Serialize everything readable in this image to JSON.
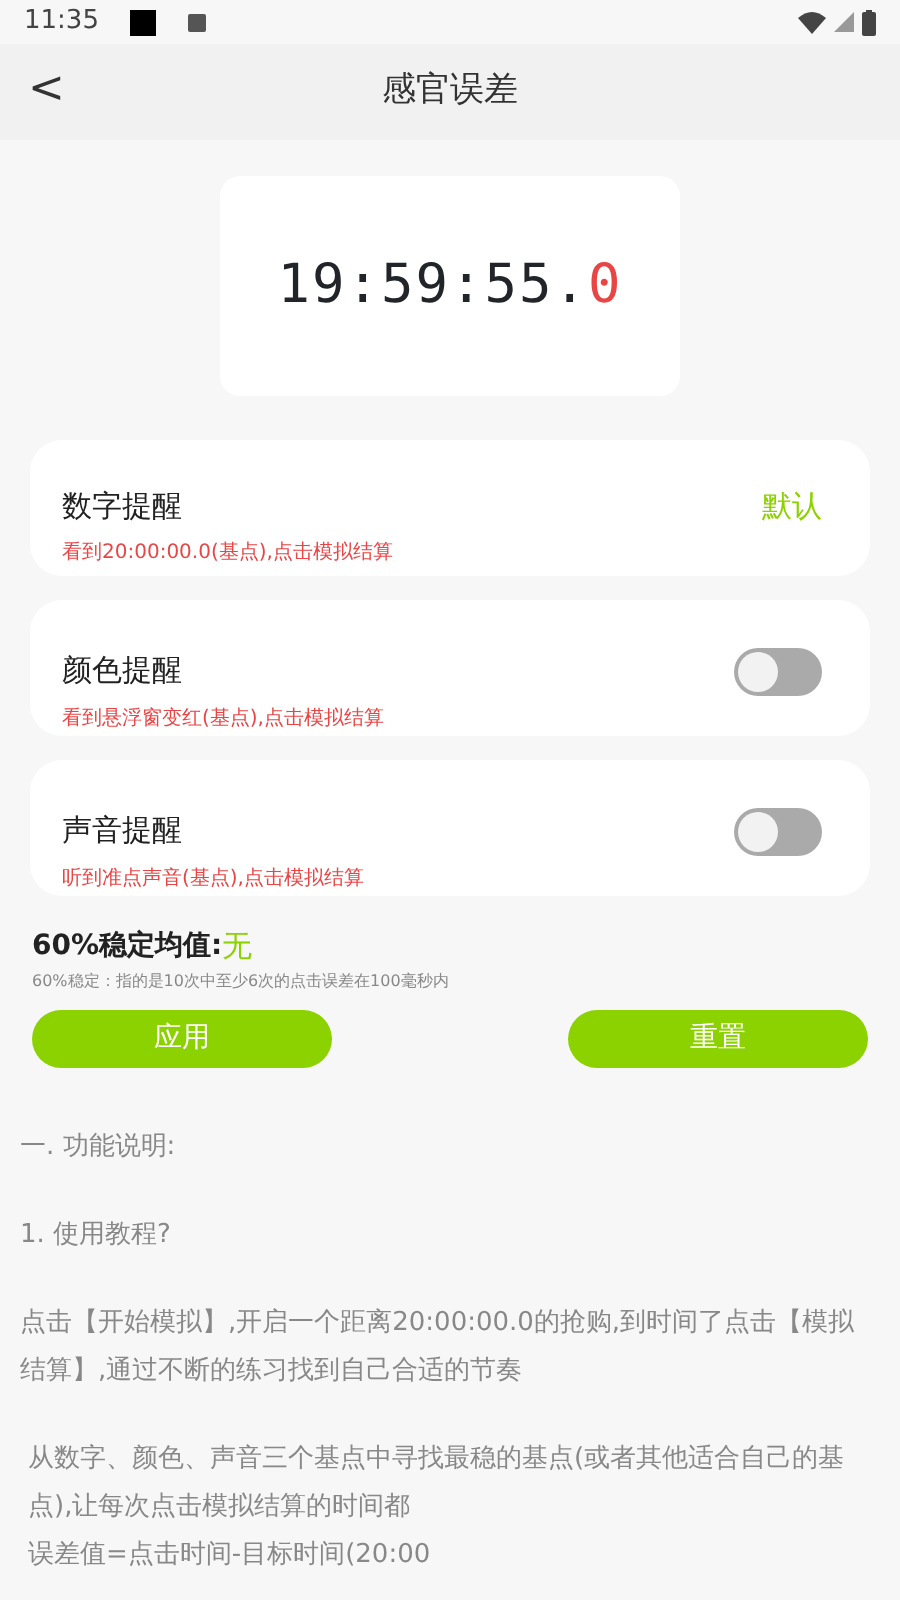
{
  "status_bar": {
    "time": "11:35"
  },
  "header": {
    "back": "<",
    "title": "感官误差"
  },
  "clock": {
    "main": "19:59:55.",
    "tenth": "0"
  },
  "reminders": [
    {
      "kind": "text",
      "title": "数字提醒",
      "hint": "看到20:00:00.0(基点),点击模拟结算",
      "value": "默认"
    },
    {
      "kind": "switch",
      "title": "颜色提醒",
      "hint": "看到悬浮窗变红(基点),点击模拟结算",
      "on": false
    },
    {
      "kind": "switch",
      "title": "声音提醒",
      "hint": "听到准点声音(基点),点击模拟结算",
      "on": false
    }
  ],
  "stable": {
    "label": "60%稳定均值:",
    "value": "无",
    "note": "60%稳定：指的是10次中至少6次的点击误差在100毫秒内"
  },
  "buttons": [
    "应用",
    "重置"
  ],
  "instructions": [
    "一. 功能说明:",
    "1. 使用教程?",
    "点击【开始模拟】,开启一个距离20:00:00.0的抢购,到时间了点击【模拟结算】,通过不断的练习找到自己合适的节奏",
    "从数字、颜色、声音三个基点中寻找最稳的基点(或者其他适合自己的基点),让每次点击模拟结算的时间都",
    "误差值=点击时间-目标时间(20:00"
  ]
}
